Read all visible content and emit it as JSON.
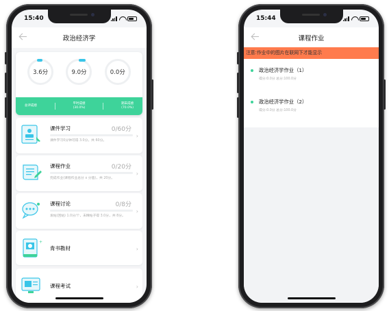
{
  "left_phone": {
    "status_time": "15:40",
    "nav_title": "政治经济学",
    "scores": [
      {
        "value": "3.6分",
        "label": "总评成绩"
      },
      {
        "value": "9.0分",
        "label": "平时成绩",
        "sub": "(30.0%)"
      },
      {
        "value": "0.0分",
        "label": "期末成绩",
        "sub": "(70.0%)"
      }
    ],
    "modules": [
      {
        "title": "课件学习",
        "score": "0/60分",
        "desc": "课件学习0分钟可得 3.0分，共 60分。",
        "icon": "courseware-icon"
      },
      {
        "title": "课程作业",
        "score": "0/20分",
        "desc": "完成作业(课程作业总分 x 分值)，共 20分。",
        "icon": "homework-icon"
      },
      {
        "title": "课程讨论",
        "score": "0/8分",
        "desc": "发帖(回帖) 1.0分/个，未精帖子得 3.0分，共 8分。",
        "icon": "discussion-icon"
      },
      {
        "title": "青书教材",
        "score": "",
        "desc": "",
        "icon": "textbook-icon"
      },
      {
        "title": "课程考试",
        "score": "",
        "desc": "",
        "icon": "exam-icon"
      }
    ]
  },
  "right_phone": {
    "status_time": "15:44",
    "nav_title": "课程作业",
    "notice": "注意:作业中的图片在联网下才能显示",
    "homework": [
      {
        "title": "政治经济学作业（1）",
        "meta": "得分:0.0分  总分:100.0分"
      },
      {
        "title": "政治经济学作业（2）",
        "meta": "得分:0.0分  总分:100.0分"
      }
    ]
  },
  "colors": {
    "accent_green": "#3ed39a",
    "accent_blue": "#39c5e8",
    "notice_orange": "#ff7b4d"
  }
}
